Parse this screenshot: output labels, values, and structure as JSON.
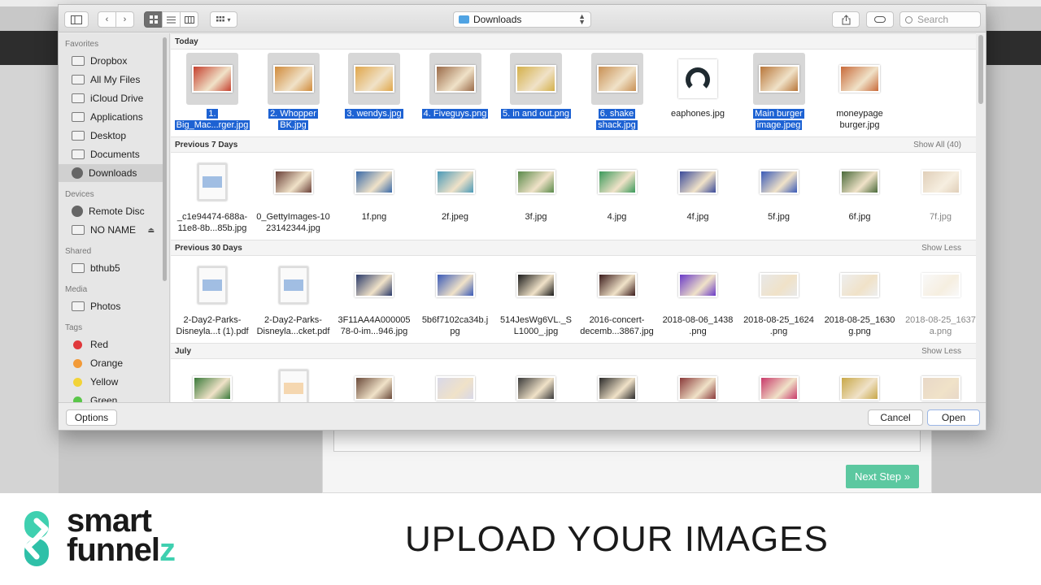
{
  "toolbar": {
    "location": "Downloads",
    "search_placeholder": "Search"
  },
  "sidebar": {
    "sections": [
      {
        "heading": "Favorites",
        "items": [
          {
            "label": "Dropbox",
            "icon": "folder-icon"
          },
          {
            "label": "All My Files",
            "icon": "all-files-icon"
          },
          {
            "label": "iCloud Drive",
            "icon": "cloud-icon"
          },
          {
            "label": "Applications",
            "icon": "applications-icon"
          },
          {
            "label": "Desktop",
            "icon": "desktop-icon"
          },
          {
            "label": "Documents",
            "icon": "documents-icon"
          },
          {
            "label": "Downloads",
            "icon": "downloads-icon",
            "selected": true
          }
        ]
      },
      {
        "heading": "Devices",
        "items": [
          {
            "label": "Remote Disc",
            "icon": "disc-icon"
          },
          {
            "label": "NO NAME",
            "icon": "drive-icon",
            "eject": true
          }
        ]
      },
      {
        "heading": "Shared",
        "items": [
          {
            "label": "bthub5",
            "icon": "monitor-icon"
          }
        ]
      },
      {
        "heading": "Media",
        "items": [
          {
            "label": "Photos",
            "icon": "camera-icon"
          }
        ]
      },
      {
        "heading": "Tags",
        "items": [
          {
            "label": "Red",
            "color": "#e0383b"
          },
          {
            "label": "Orange",
            "color": "#f29a38"
          },
          {
            "label": "Yellow",
            "color": "#f2d338"
          },
          {
            "label": "Green",
            "color": "#5ac649"
          }
        ]
      }
    ]
  },
  "sections": [
    {
      "title": "Today",
      "action": "",
      "files": [
        {
          "name": "1. Big_Mac...rger.jpg",
          "lines": [
            "1.",
            "Big_Mac...rger.jpg"
          ],
          "selected": true,
          "thumb": "#c5402e"
        },
        {
          "name": "2. Whopper BK.jpg",
          "lines": [
            "2. Whopper",
            "BK.jpg"
          ],
          "selected": true,
          "thumb": "#d08a3a"
        },
        {
          "name": "3. wendys.jpg",
          "lines": [
            "3. wendys.jpg"
          ],
          "selected": true,
          "thumb": "#e0a64a"
        },
        {
          "name": "4. Fiveguys.png",
          "lines": [
            "4. Fiveguys.png"
          ],
          "selected": true,
          "thumb": "#9a6a48"
        },
        {
          "name": "5. in and out.png",
          "lines": [
            "5. in and out.png"
          ],
          "selected": true,
          "thumb": "#d4b04a"
        },
        {
          "name": "6. shake shack.jpg",
          "lines": [
            "6. shake",
            "shack.jpg"
          ],
          "selected": true,
          "thumb": "#c89054"
        },
        {
          "name": "eaphones.jpg",
          "lines": [
            "eaphones.jpg"
          ],
          "selected": false,
          "thumb": "#1f2a30"
        },
        {
          "name": "Main burger image.jpeg",
          "lines": [
            "Main burger",
            "image.jpeg"
          ],
          "selected": true,
          "thumb": "#b8763a"
        },
        {
          "name": "moneypage burger.jpg",
          "lines": [
            "moneypage",
            "burger.jpg"
          ],
          "selected": false,
          "thumb": "#c86a3a"
        }
      ]
    },
    {
      "title": "Previous 7 Days",
      "action": "Show All (40)",
      "files": [
        {
          "name": "_c1e94474-688a-11e8-8b...85b.jpg",
          "lines": [
            "_c1e94474-688a-",
            "11e8-8b...85b.jpg"
          ],
          "kind": "doc",
          "thumb": "#ffffff"
        },
        {
          "name": "0_GettyImages-1023142344.jpg",
          "lines": [
            "0_GettyImages-10",
            "23142344.jpg"
          ],
          "thumb": "#6a4038"
        },
        {
          "name": "1f.png",
          "lines": [
            "1f.png"
          ],
          "thumb": "#3a6aa8"
        },
        {
          "name": "2f.jpeg",
          "lines": [
            "2f.jpeg"
          ],
          "thumb": "#4a9ab8"
        },
        {
          "name": "3f.jpg",
          "lines": [
            "3f.jpg"
          ],
          "thumb": "#5a8a4a"
        },
        {
          "name": "4.jpg",
          "lines": [
            "4.jpg"
          ],
          "thumb": "#3a9a5a"
        },
        {
          "name": "4f.jpg",
          "lines": [
            "4f.jpg"
          ],
          "thumb": "#3a4a9a"
        },
        {
          "name": "5f.jpg",
          "lines": [
            "5f.jpg"
          ],
          "thumb": "#3a5ab8"
        },
        {
          "name": "6f.jpg",
          "lines": [
            "6f.jpg"
          ],
          "thumb": "#4a6a3a"
        },
        {
          "name": "7f.jpg",
          "lines": [
            "7f.jpg"
          ],
          "thumb": "#c8a880",
          "faded": true
        }
      ]
    },
    {
      "title": "Previous 30 Days",
      "action": "Show Less",
      "files": [
        {
          "name": "2-Day2-Parks-Disneyla...t (1).pdf",
          "lines": [
            "2-Day2-Parks-",
            "Disneyla...t (1).pdf"
          ],
          "kind": "doc",
          "thumb": "#ffffff"
        },
        {
          "name": "2-Day2-Parks-Disneyla...cket.pdf",
          "lines": [
            "2-Day2-Parks-",
            "Disneyla...cket.pdf"
          ],
          "kind": "doc",
          "thumb": "#ffffff"
        },
        {
          "name": "3F11AA4A00000578-0-im...946.jpg",
          "lines": [
            "3F11AA4A000005",
            "78-0-im...946.jpg"
          ],
          "thumb": "#2a3a6a"
        },
        {
          "name": "5b6f7102ca34b.jpg",
          "lines": [
            "5b6f7102ca34b.j",
            "pg"
          ],
          "thumb": "#3a5ab8"
        },
        {
          "name": "514JesWg6VL._SL1000_.jpg",
          "lines": [
            "514JesWg6VL._S",
            "L1000_.jpg"
          ],
          "thumb": "#1a1a1a"
        },
        {
          "name": "2016-concert-decemb...3867.jpg",
          "lines": [
            "2016-concert-",
            "decemb...3867.jpg"
          ],
          "thumb": "#3a1a1a"
        },
        {
          "name": "2018-08-06_1438.png",
          "lines": [
            "2018-08-06_1438",
            ".png"
          ],
          "thumb": "#6a3ac8"
        },
        {
          "name": "2018-08-25_1624.png",
          "lines": [
            "2018-08-25_1624",
            ".png"
          ],
          "thumb": "#e8e8e8"
        },
        {
          "name": "2018-08-25_1630g.png",
          "lines": [
            "2018-08-25_1630",
            "g.png"
          ],
          "thumb": "#eeeeee"
        },
        {
          "name": "2018-08-25_1637a.png",
          "lines": [
            "2018-08-25_1637",
            "a.png"
          ],
          "thumb": "#f4f4f4",
          "faded": true
        }
      ]
    },
    {
      "title": "July",
      "action": "Show Less",
      "files": [
        {
          "name": "",
          "lines": [],
          "thumb": "#3a7a3a"
        },
        {
          "name": "",
          "lines": [],
          "kind": "doc",
          "thumb": "#f2c890"
        },
        {
          "name": "",
          "lines": [],
          "thumb": "#6a4a3a"
        },
        {
          "name": "",
          "lines": [],
          "thumb": "#d8d8e8"
        },
        {
          "name": "",
          "lines": [],
          "thumb": "#3a3a3a"
        },
        {
          "name": "",
          "lines": [],
          "thumb": "#2a2a2a"
        },
        {
          "name": "",
          "lines": [],
          "thumb": "#8a3a3a"
        },
        {
          "name": "",
          "lines": [],
          "thumb": "#c83a6a"
        },
        {
          "name": "",
          "lines": [],
          "thumb": "#c8a848"
        },
        {
          "name": "",
          "lines": [],
          "thumb": "#e8d8c8"
        }
      ]
    }
  ],
  "footer": {
    "options_label": "Options",
    "cancel_label": "Cancel",
    "open_label": "Open"
  },
  "background": {
    "next_step_label": "Next Step »"
  },
  "branding": {
    "logo_line1": "smart",
    "logo_line2_a": "funnel",
    "logo_line2_b": "z",
    "slogan": "UPLOAD YOUR IMAGES",
    "accent_color": "#3fd0b0"
  }
}
